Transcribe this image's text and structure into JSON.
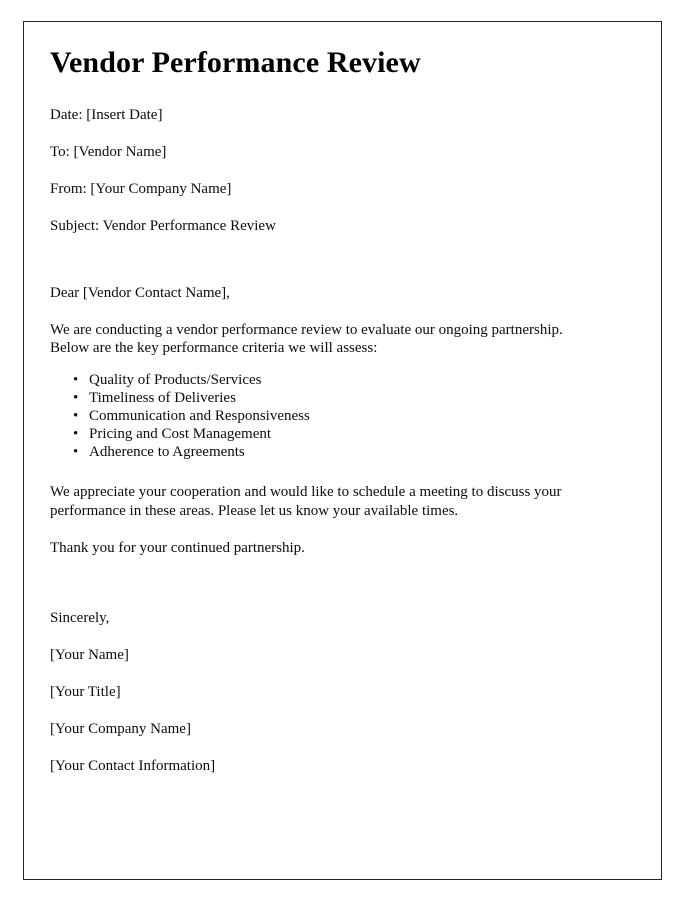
{
  "document": {
    "title": "Vendor Performance Review",
    "meta_fields": [
      "Date: [Insert Date]",
      "To: [Vendor Name]",
      "From: [Your Company Name]",
      "Subject: Vendor Performance Review"
    ],
    "salutation": "Dear [Vendor Contact Name],",
    "intro_paragraph": "We are conducting a vendor performance review to evaluate our ongoing partnership. Below are the key performance criteria we will assess:",
    "criteria": [
      "Quality of Products/Services",
      "Timeliness of Deliveries",
      "Communication and Responsiveness",
      "Pricing and Cost Management",
      "Adherence to Agreements"
    ],
    "request_paragraph": "We appreciate your cooperation and would like to schedule a meeting to discuss your performance in these areas. Please let us know your available times.",
    "thanks_paragraph": "Thank you for your continued partnership.",
    "closing": "Sincerely,",
    "signature_lines": [
      "[Your Name]",
      "[Your Title]",
      "[Your Company Name]",
      "[Your Contact Information]"
    ]
  }
}
